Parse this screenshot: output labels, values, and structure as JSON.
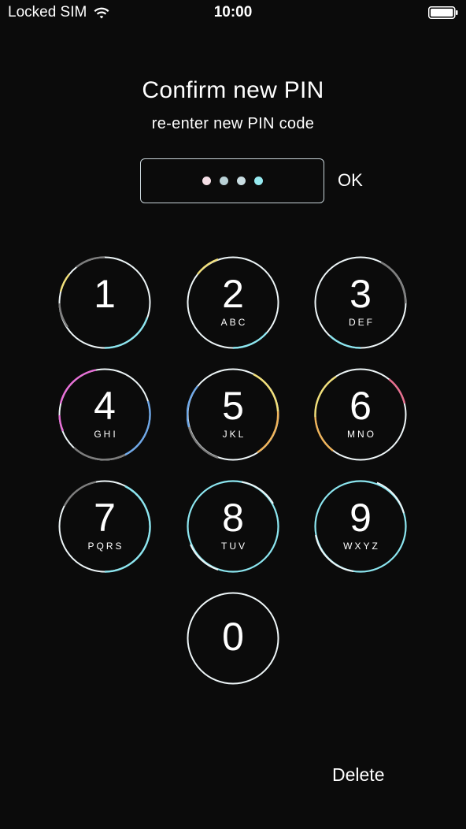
{
  "status_bar": {
    "carrier": "Locked SIM",
    "time": "10:00",
    "wifi_icon": "wifi-icon",
    "battery_icon": "battery-icon"
  },
  "header": {
    "title": "Confirm new PIN",
    "subtitle": "re-enter new PIN code"
  },
  "pin_entry": {
    "dots_filled": 4,
    "dot_colors": [
      "#f5dfe6",
      "#b9d1d6",
      "#c9dde2",
      "#96eaf0"
    ],
    "ok_label": "OK"
  },
  "keypad": {
    "keys": [
      {
        "digit": "1",
        "letters": ""
      },
      {
        "digit": "2",
        "letters": "ABC"
      },
      {
        "digit": "3",
        "letters": "DEF"
      },
      {
        "digit": "4",
        "letters": "GHI"
      },
      {
        "digit": "5",
        "letters": "JKL"
      },
      {
        "digit": "6",
        "letters": "MNO"
      },
      {
        "digit": "7",
        "letters": "PQRS"
      },
      {
        "digit": "8",
        "letters": "TUV"
      },
      {
        "digit": "9",
        "letters": "WXYZ"
      },
      {
        "digit": "0",
        "letters": ""
      }
    ]
  },
  "footer": {
    "delete_label": "Delete"
  },
  "colors": {
    "background": "#0b0b0b",
    "text": "#ffffff",
    "ring_base": "#eef6f8",
    "ring_accent_cyan": "#8ce6f0",
    "ring_accent_blue": "#6fa8e8",
    "ring_accent_pink": "#e86fd8",
    "ring_accent_orange": "#f0b45a",
    "ring_accent_yellow": "#f2e07a",
    "ring_accent_grey": "#7d7d7d"
  }
}
